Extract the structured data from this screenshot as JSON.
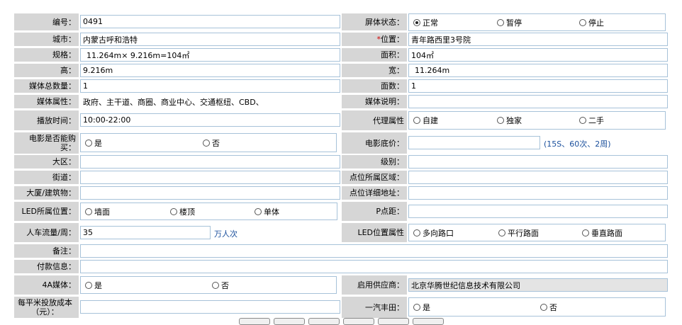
{
  "rows": {
    "r1": {
      "l1": "编号：",
      "v1": "0491",
      "l2": "屏体状态：",
      "opts2": [
        "正常",
        "暂停",
        "停止"
      ]
    },
    "r2": {
      "l1": "城市：",
      "v1": "内蒙古呼和浩特",
      "l2_star": "*",
      "l2": "位置：",
      "v2": "青年路西里3号院"
    },
    "r3": {
      "l1": "规格：",
      "v1": "11.264m× 9.216m=104㎡",
      "l2": "面积：",
      "v2": "104㎡"
    },
    "r4": {
      "l1": "高：",
      "v1": "9.216m",
      "l2": "宽：",
      "v2": "11.264m"
    },
    "r5": {
      "l1": "媒体总数量：",
      "v1": "1",
      "l2": "面数：",
      "v2": "1"
    },
    "r6": {
      "l1": "媒体属性：",
      "v1": "政府、主干道、商圈、商业中心、交通枢纽、CBD、",
      "l2": "媒体说明：",
      "v2": ""
    },
    "r7": {
      "l1": "播放时间：",
      "v1": "10:00-22:00",
      "l2": "代理属性",
      "opts2": [
        "自建",
        "独家",
        "二手"
      ]
    },
    "r8": {
      "l1": "电影是否能购买：",
      "opts1": [
        "是",
        "否"
      ],
      "l2": "电影底价：",
      "v2": "",
      "hint": "(15S、60次、2周)"
    },
    "r9": {
      "l1": "大区：",
      "v1": "",
      "l2": "级别：",
      "v2": ""
    },
    "r10": {
      "l1": "街道：",
      "v1": "",
      "l2": "点位所属区域：",
      "v2": ""
    },
    "r11": {
      "l1": "大厦/建筑物：",
      "v1": "",
      "l2": "点位详细地址：",
      "v2": ""
    },
    "r12": {
      "l1": "LED所属位置：",
      "opts1": [
        "墙面",
        "楼顶",
        "单体"
      ],
      "l2": "P点距：",
      "v2": ""
    },
    "r13": {
      "l1": "人车流量/周：",
      "v1": "35",
      "unit": "万人次",
      "l2": "LED位置属性",
      "opts2": [
        "多向路口",
        "平行路面",
        "垂直路面"
      ]
    },
    "r14": {
      "l1": "备注：",
      "v1": ""
    },
    "r15": {
      "l1": "付款信息：",
      "v1": ""
    },
    "r16": {
      "l1": "4A媒体：",
      "opts1": [
        "是",
        "否"
      ],
      "l2": "启用供应商：",
      "v2": "北京华腾世纪信息技术有限公司"
    },
    "r17": {
      "l1": "每平米投放成本（元）：",
      "v1": "",
      "l2": "一汽丰田：",
      "opts2": [
        "是",
        "否"
      ]
    }
  },
  "selected": {
    "screen_status": "正常"
  },
  "colors": {
    "label_bg": "#d6d6d6",
    "border": "#a7c2d9",
    "hint": "#1a4f9c",
    "required": "#d00000"
  }
}
